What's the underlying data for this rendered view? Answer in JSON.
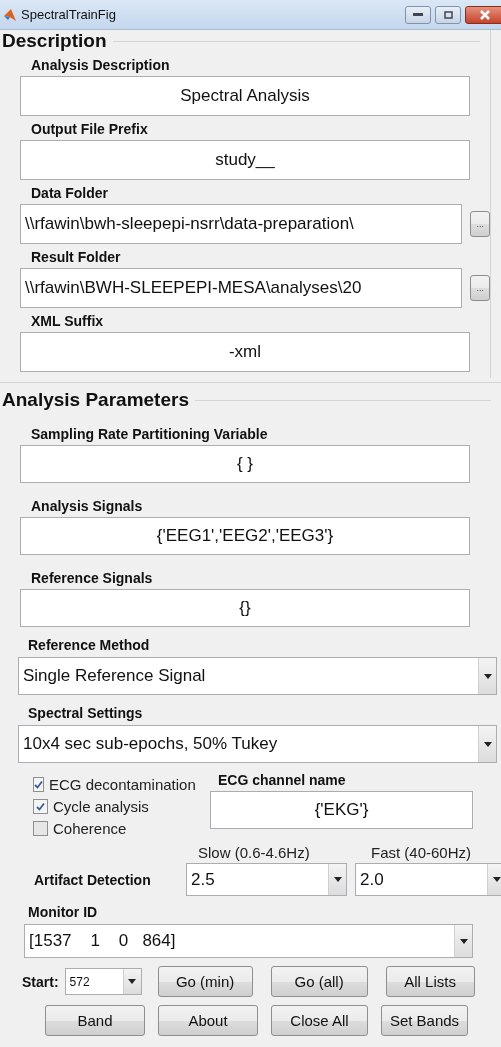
{
  "window": {
    "title": "SpectralTrainFig"
  },
  "description": {
    "heading": "Description",
    "fields": [
      {
        "label": "Analysis Description",
        "value": "Spectral Analysis",
        "kind": "text"
      },
      {
        "label": "Output File Prefix",
        "value": "study__",
        "kind": "text"
      },
      {
        "label": "Data Folder",
        "value": "\\\\rfawin\\bwh-sleepepi-nsrr\\data-preparation\\",
        "kind": "path",
        "browse": "..."
      },
      {
        "label": "Result Folder",
        "value": "\\\\rfawin\\BWH-SLEEPEPI-MESA\\analyses\\20",
        "kind": "path",
        "browse": "..."
      },
      {
        "label": "XML Suffix",
        "value": "-xml",
        "kind": "text"
      }
    ]
  },
  "analysis_parameters": {
    "heading": "Analysis Parameters",
    "fields": [
      {
        "label": "Sampling Rate Partitioning Variable",
        "value": "{ }"
      },
      {
        "label": "Analysis Signals",
        "value": "{'EEG1','EEG2','EEG3'}"
      },
      {
        "label": "Reference Signals",
        "value": "{}"
      }
    ],
    "reference_method": {
      "label": "Reference Method",
      "value": "Single Reference Signal"
    },
    "spectral_settings": {
      "label": "Spectral Settings",
      "value": "10x4 sec sub-epochs, 50% Tukey"
    },
    "options": [
      {
        "label": "ECG decontamination",
        "checked": true
      },
      {
        "label": "Cycle analysis",
        "checked": true
      },
      {
        "label": "Coherence",
        "checked": false
      }
    ],
    "ecg_channel": {
      "label": "ECG channel name",
      "value": "{'EKG'}"
    },
    "artifact_detection": {
      "label": "Artifact Detection",
      "slow": {
        "label": "Slow (0.6-4.6Hz)",
        "value": "2.5"
      },
      "fast": {
        "label": "Fast (40-60Hz)",
        "value": "2.0"
      }
    },
    "monitor_id": {
      "label": "Monitor ID",
      "value": "[1537    1    0   864]"
    },
    "start": {
      "label": "Start:",
      "value": "572"
    },
    "buttons": [
      [
        "Go (min)",
        "Go (all)",
        "All Lists"
      ],
      [
        "Band",
        "About",
        "Close All",
        "Set Bands"
      ]
    ]
  }
}
